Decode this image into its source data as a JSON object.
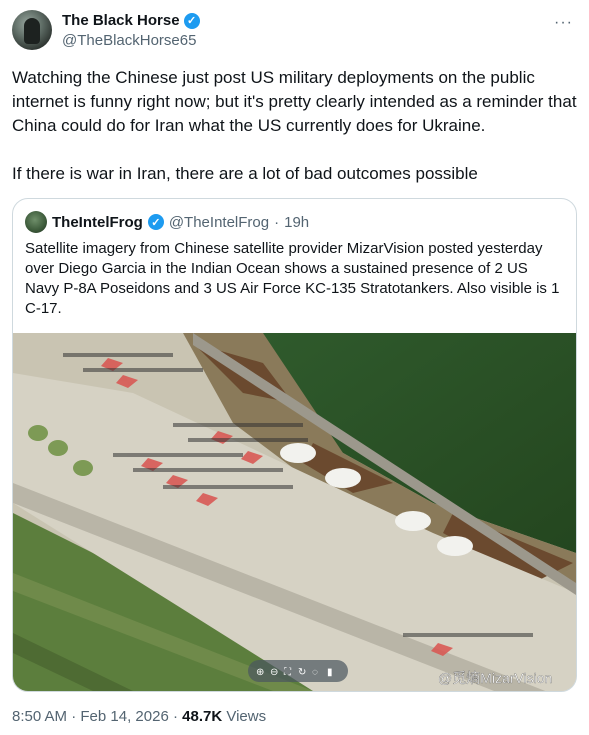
{
  "author": {
    "name": "The Black Horse",
    "handle": "@TheBlackHorse65"
  },
  "more_icon": "more-horizontal-icon",
  "tweet": {
    "paragraph1": "Watching the Chinese just post US military deployments on the public internet is funny right now; but it's pretty clearly intended as a reminder that China could do for Iran what the US currently does for Ukraine.",
    "paragraph2": "If there is war in Iran, there are a lot of bad outcomes possible"
  },
  "quote": {
    "name": "TheIntelFrog",
    "handle": "@TheIntelFrog",
    "separator": "·",
    "age": "19h",
    "text": "Satellite imagery from Chinese satellite provider MizarVision posted yesterday over Diego Garcia in the Indian Ocean shows a sustained presence of 2 US Navy P-8A Poseidons and 3 US Air Force KC-135 Stratotankers.  Also visible is 1 C-17.",
    "image": {
      "watermark": "@觅熵MizarVision"
    }
  },
  "footer": {
    "time": "8:50 AM",
    "separator1": "·",
    "date": "Feb 14, 2026",
    "separator2": "·",
    "views_count": "48.7K",
    "views_label": "Views"
  },
  "colors": {
    "verified": "#1d9bf0",
    "secondary_text": "#536471",
    "border": "#cfd9de"
  }
}
